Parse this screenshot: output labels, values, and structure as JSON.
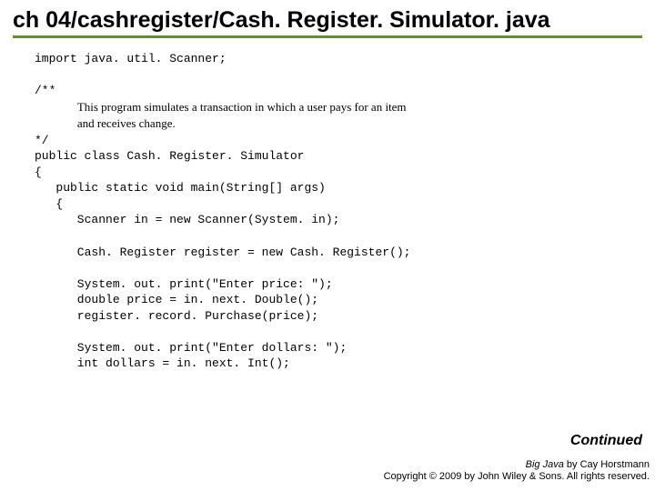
{
  "title": "ch 04/cashregister/Cash. Register. Simulator. java",
  "code": {
    "l01": "import java. util. Scanner;",
    "l02": "",
    "l03": "/**",
    "doc1": "This program simulates a transaction in which a user pays for an item",
    "doc2": "and receives change.",
    "l04": "*/",
    "l05": "public class Cash. Register. Simulator",
    "l06": "{",
    "l07": "   public static void main(String[] args)",
    "l08": "   {",
    "l09": "      Scanner in = new Scanner(System. in);",
    "l10": "",
    "l11": "      Cash. Register register = new Cash. Register();",
    "l12": "",
    "l13": "      System. out. print(\"Enter price: \");",
    "l14": "      double price = in. next. Double();",
    "l15": "      register. record. Purchase(price);",
    "l16": "",
    "l17": "      System. out. print(\"Enter dollars: \");",
    "l18": "      int dollars = in. next. Int();"
  },
  "continued": "Continued",
  "footer": {
    "book": "Big Java",
    "author": " by Cay Horstmann",
    "copyright": "Copyright © 2009 by John Wiley & Sons. All rights reserved."
  }
}
